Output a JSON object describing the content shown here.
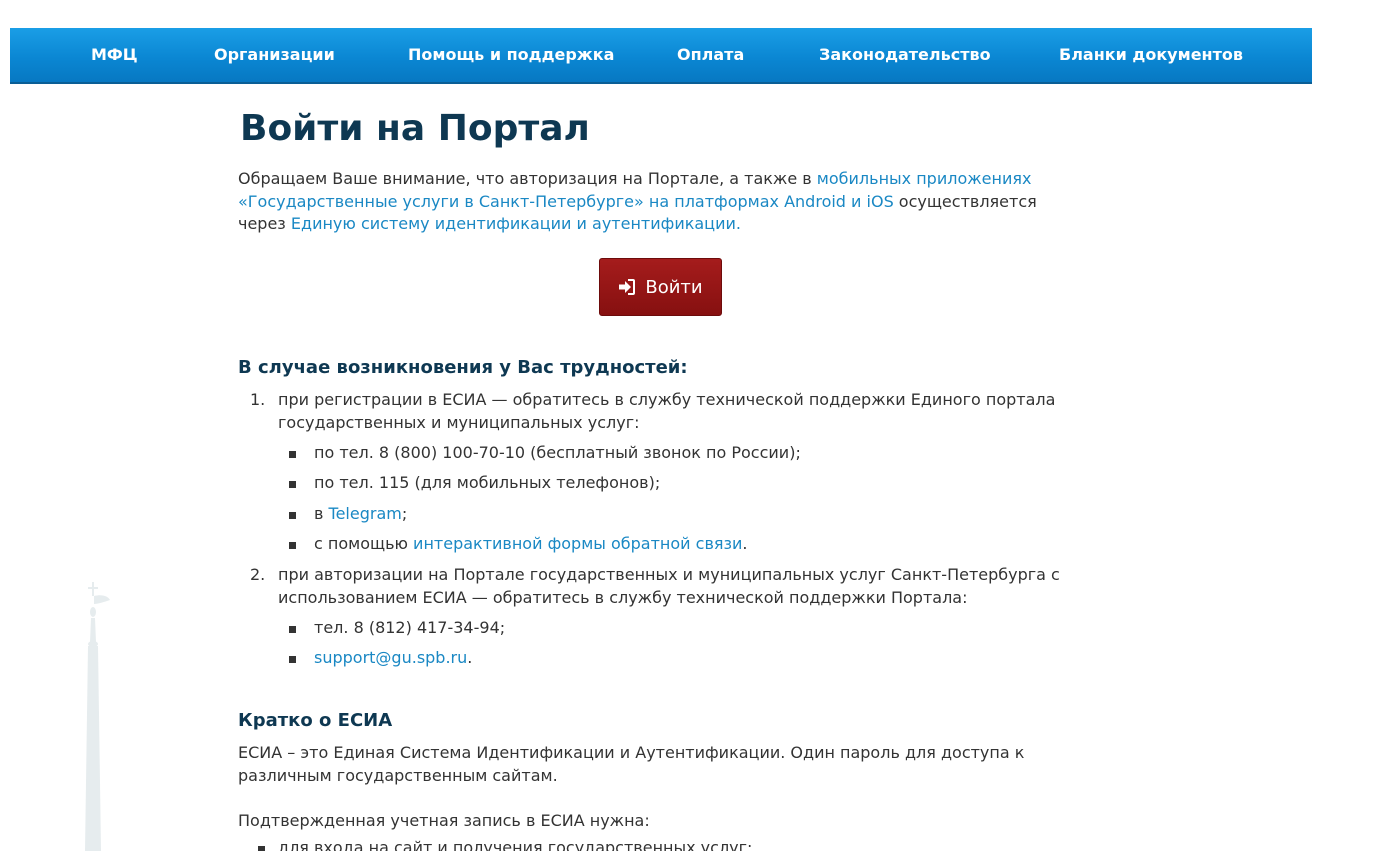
{
  "nav": {
    "items": [
      {
        "label": "МФЦ"
      },
      {
        "label": "Организации"
      },
      {
        "label": "Помощь и поддержка"
      },
      {
        "label": "Оплата"
      },
      {
        "label": "Законодательство"
      },
      {
        "label": "Бланки документов"
      }
    ]
  },
  "main": {
    "title": "Войти на Портал",
    "intro": {
      "text1": "Обращаем Ваше внимание, что авторизация на Портале, а также в ",
      "link1": "мобильных приложениях «Государственные услуги в Санкт-Петербурге» на платформах Android и iOS",
      "text2": " осуществляется через ",
      "link2": "Единую систему идентификации и аутентификации."
    },
    "login_button": "Войти",
    "login_icon": "sign-in-icon"
  },
  "trouble": {
    "heading": "В случае возникновения у Вас трудностей:",
    "item1": {
      "num": "1.",
      "text": "при регистрации в ЕСИА — обратитесь в службу технической поддержки Единого портала государственных и муниципальных услуг:",
      "sub": {
        "phone": "по тел. 8 (800) 100-70-10 (бесплатный звонок по России);",
        "mobile": "по тел. 115 (для мобильных телефонов);",
        "tg_prefix": "в ",
        "tg_link": "Telegram",
        "tg_suffix": ";",
        "form_prefix": "с помощью ",
        "form_link": "интерактивной формы обратной связи",
        "form_suffix": "."
      }
    },
    "item2": {
      "num": "2.",
      "text": "при авторизации на Портале государственных и муниципальных услуг Санкт-Петербурга с использованием ЕСИА — обратитесь в службу технической поддержки Портала:",
      "sub": {
        "phone": "тел. 8 (812) 417-34-94;",
        "email_link": "support@gu.spb.ru",
        "email_suffix": "."
      }
    }
  },
  "about": {
    "heading": "Кратко о ЕСИА",
    "description": "ЕСИА – это Единая Система Идентификации и Аутентификации. Один пароль для доступа к различным государственным сайтам.",
    "needed": "Подтвержденная учетная запись в ЕСИА нужна:",
    "needed_item1": "для входа на сайт и получения государственных услуг;"
  },
  "colors": {
    "nav_bg": "#0b87d3",
    "title": "#0e3852",
    "link": "#1a88c4",
    "button": "#961515"
  }
}
